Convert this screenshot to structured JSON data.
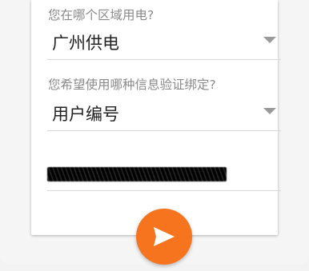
{
  "form": {
    "region_label": "您在哪个区域用电?",
    "region_value": "广州供电",
    "method_label": "您希望使用哪种信息验证绑定?",
    "method_value": "用户编号"
  },
  "submit": {
    "icon": "send-icon",
    "color": "#f7741e"
  }
}
